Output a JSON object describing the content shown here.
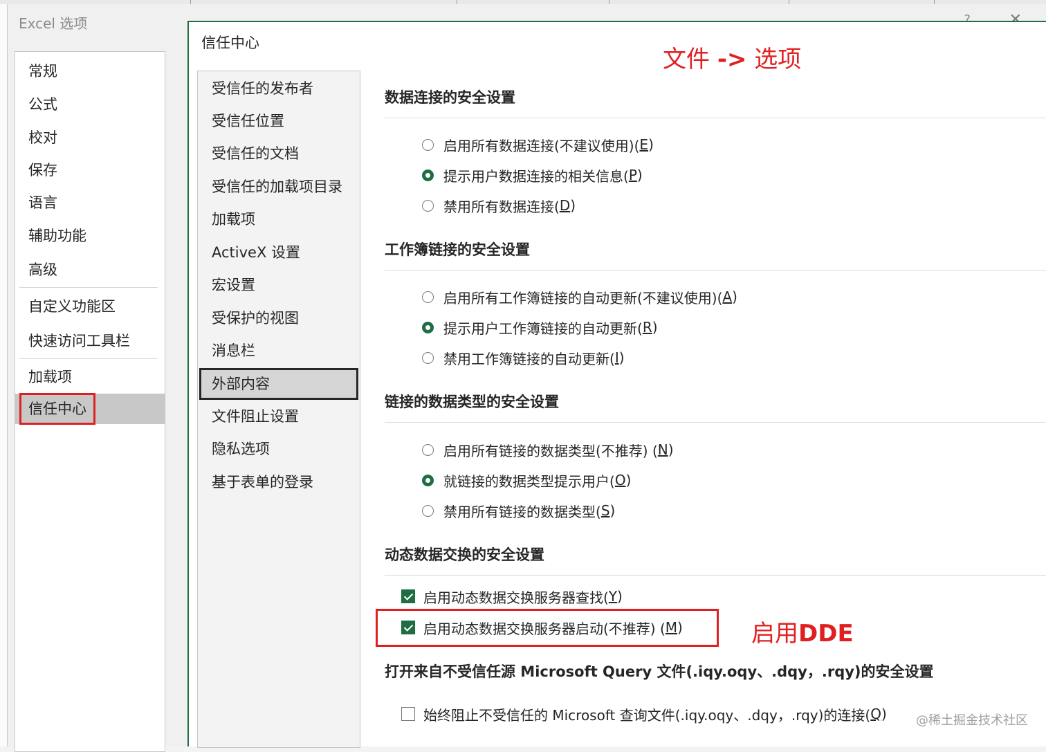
{
  "outer_window": {
    "title": "Excel 选项",
    "close_glyph": "✕",
    "help_glyph": "?",
    "nav": [
      {
        "label": "常规"
      },
      {
        "label": "公式"
      },
      {
        "label": "校对"
      },
      {
        "label": "保存"
      },
      {
        "label": "语言"
      },
      {
        "label": "辅助功能"
      },
      {
        "label": "高级"
      },
      {
        "label": "自定义功能区"
      },
      {
        "label": "快速访问工具栏"
      },
      {
        "label": "加载项"
      },
      {
        "label": "信任中心",
        "selected": true
      }
    ]
  },
  "trust_center": {
    "title": "信任中心",
    "nav": [
      {
        "label": "受信任的发布者"
      },
      {
        "label": "受信任位置"
      },
      {
        "label": "受信任的文档"
      },
      {
        "label": "受信任的加载项目录"
      },
      {
        "label": "加载项"
      },
      {
        "label": "ActiveX 设置"
      },
      {
        "label": "宏设置"
      },
      {
        "label": "受保护的视图"
      },
      {
        "label": "消息栏"
      },
      {
        "label": "外部内容",
        "selected": true
      },
      {
        "label": "文件阻止设置"
      },
      {
        "label": "隐私选项"
      },
      {
        "label": "基于表单的登录"
      }
    ],
    "sections": {
      "data_connections": {
        "title": "数据连接的安全设置",
        "options": [
          {
            "text": "启用所有数据连接(不建议使用)(",
            "key": "E",
            "end": ")",
            "checked": false
          },
          {
            "text": "提示用户数据连接的相关信息(",
            "key": "P",
            "end": ")",
            "checked": true
          },
          {
            "text": "禁用所有数据连接(",
            "key": "D",
            "end": ")",
            "checked": false
          }
        ]
      },
      "workbook_links": {
        "title": "工作簿链接的安全设置",
        "options": [
          {
            "text": "启用所有工作簿链接的自动更新(不建议使用)(",
            "key": "A",
            "end": ")",
            "checked": false
          },
          {
            "text": "提示用户工作簿链接的自动更新(",
            "key": "R",
            "end": ")",
            "checked": true
          },
          {
            "text": "禁用工作簿链接的自动更新(",
            "key": "I",
            "end": ")",
            "checked": false
          }
        ]
      },
      "linked_data_types": {
        "title": "链接的数据类型的安全设置",
        "options": [
          {
            "text": "启用所有链接的数据类型(不推荐) (",
            "key": "N",
            "end": ")",
            "checked": false
          },
          {
            "text": "就链接的数据类型提示用户(",
            "key": "O",
            "end": ")",
            "checked": true
          },
          {
            "text": "禁用所有链接的数据类型(",
            "key": "S",
            "end": ")",
            "checked": false
          }
        ]
      },
      "dde": {
        "title": "动态数据交换的安全设置",
        "options": [
          {
            "text": "启用动态数据交换服务器查找(",
            "key": "Y",
            "end": ")",
            "checked": true
          },
          {
            "text": "启用动态数据交换服务器启动(不推荐) (",
            "key": "M",
            "end": ")",
            "checked": true
          }
        ]
      },
      "ms_query": {
        "title": "打开来自不受信任源 Microsoft Query 文件(.iqy.oqy、.dqy，.rqy)的安全设置",
        "options": [
          {
            "text": "始终阻止不受信任的 Microsoft 查询文件(.iqy.oqy、.dqy，.rqy)的连接(",
            "key": "Q",
            "end": ")",
            "checked": false
          }
        ]
      }
    }
  },
  "annotations": {
    "top_prefix": "文件 ",
    "top_arrow": "->",
    "top_suffix": " 选项",
    "dde_prefix": "启用",
    "dde_bold": "DDE",
    "color": "#e02020"
  },
  "credit": "@稀土掘金技术社区",
  "colors": {
    "accent": "#1f6e43",
    "selection": "#c8c8c8",
    "annotation": "#e02020"
  }
}
